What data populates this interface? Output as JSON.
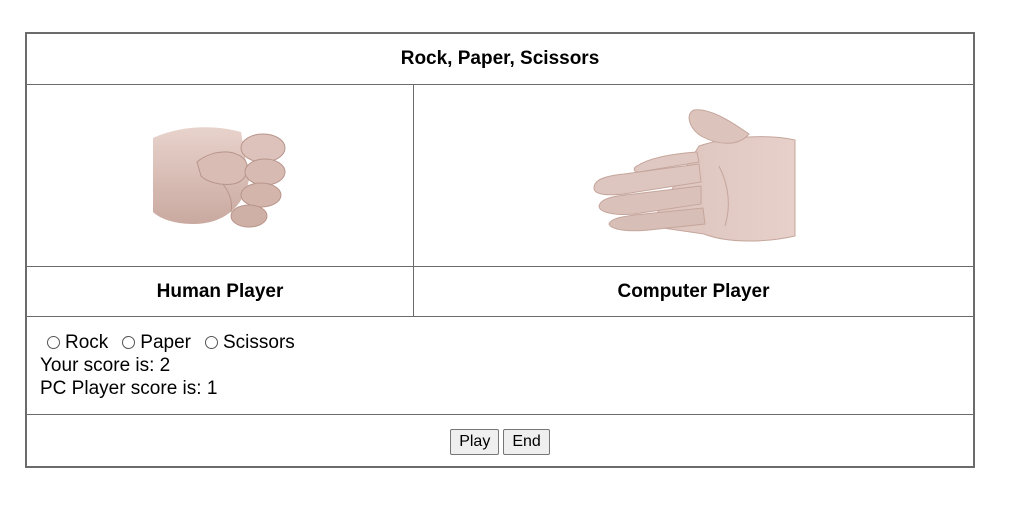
{
  "game": {
    "title": "Rock, Paper, Scissors",
    "human_label": "Human Player",
    "computer_label": "Computer Player",
    "human_choice": "rock",
    "computer_choice": "paper",
    "options": [
      "Rock",
      "Paper",
      "Scissors"
    ],
    "your_score_text": "Your score is: 2",
    "pc_score_text": "PC Player score is: 1",
    "play_label": "Play",
    "end_label": "End"
  }
}
